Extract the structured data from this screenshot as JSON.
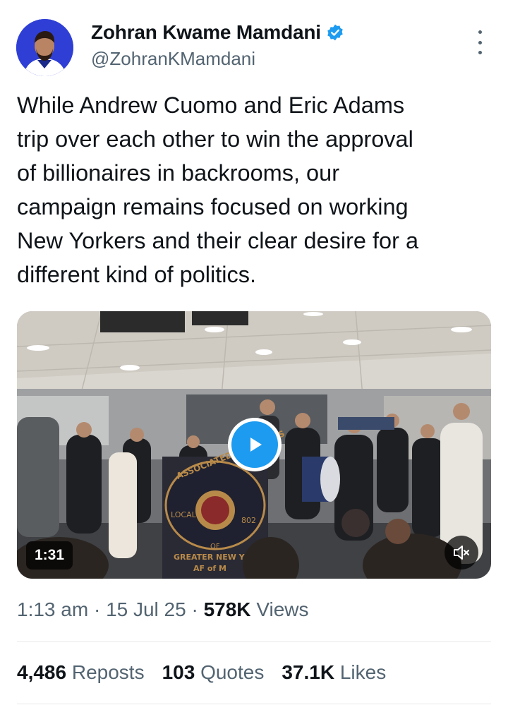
{
  "author": {
    "display_name": "Zohran Kwame Mamdani",
    "handle": "@ZohranKMamdani",
    "verified": true,
    "avatar_bg": "#2f3fd6"
  },
  "tweet": {
    "text": "While Andrew Cuomo and Eric Adams\ntrip over each other to win the approval\nof billionaires in backrooms, our\ncampaign remains focused on working\nNew Yorkers and their clear desire for a\ndifferent kind of politics."
  },
  "media": {
    "type": "video",
    "duration": "1:31",
    "banner_lines": [
      "ASSOCIATED MUSICIANS",
      "LOCAL",
      "802",
      "OF",
      "GREATER NEW YO",
      "AF of M"
    ],
    "play_color": "#1d9bf0"
  },
  "meta": {
    "time": "1:13 am",
    "date": "15 Jul 25",
    "views_count": "578K",
    "views_label": "Views"
  },
  "stats": {
    "reposts_count": "4,486",
    "reposts_label": "Reposts",
    "quotes_count": "103",
    "quotes_label": "Quotes",
    "likes_count": "37.1K",
    "likes_label": "Likes"
  },
  "colors": {
    "text_primary": "#0f1419",
    "text_secondary": "#536471",
    "accent": "#1d9bf0",
    "divider": "#e7e9ea"
  }
}
